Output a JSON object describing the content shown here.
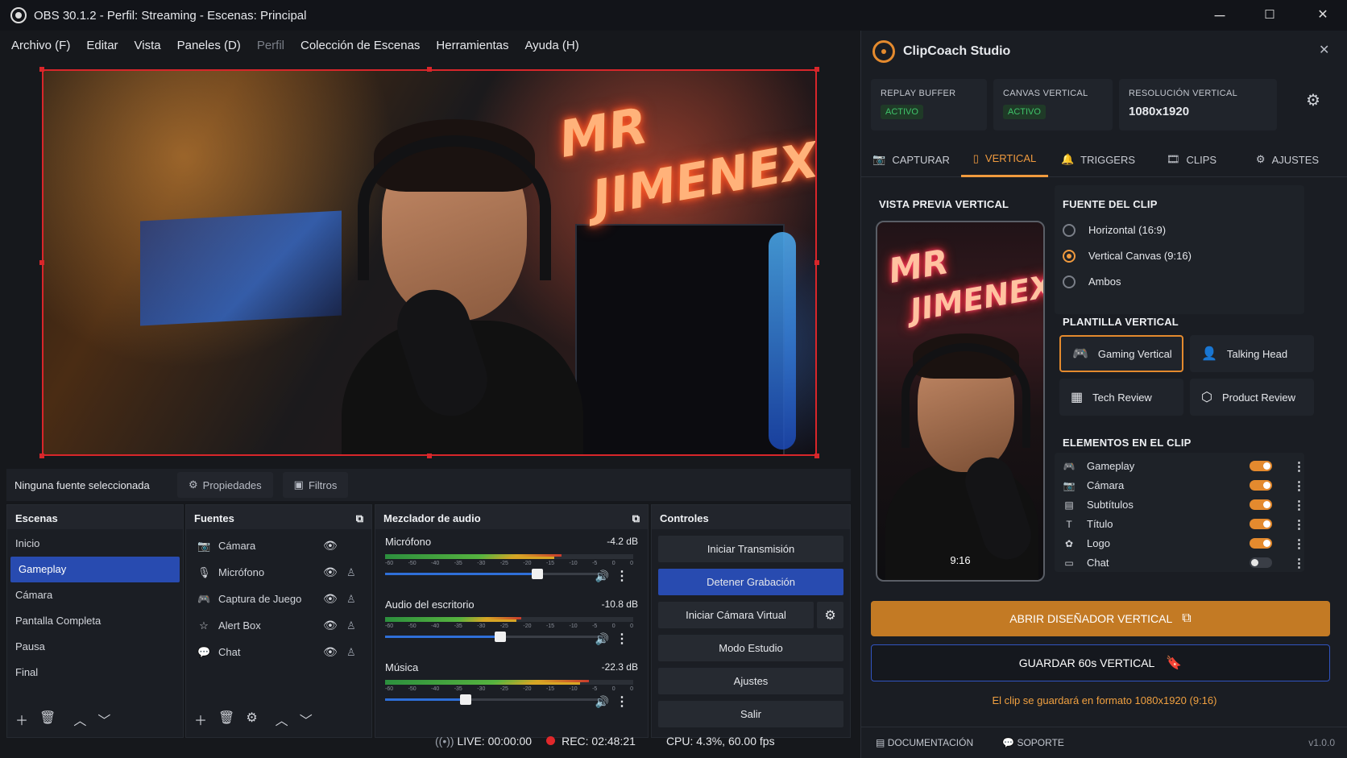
{
  "window": {
    "title": "OBS 30.1.2 - Perfil: Streaming - Escenas: Principal",
    "min": "─",
    "max": "☐",
    "close": "✕"
  },
  "menu": [
    "Archivo (F)",
    "Editar",
    "Vista",
    "Paneles (D)",
    "Perfil",
    "Colección de Escenas",
    "Herramientas",
    "Ayuda (H)"
  ],
  "preview": {
    "neon_line1": "MR",
    "neon_line2": "JIMENEX"
  },
  "source_bar": {
    "status": "Ninguna fuente seleccionada",
    "properties": "Propiedades",
    "filters": "Filtros"
  },
  "scenes": {
    "title": "Escenas",
    "items": [
      "Inicio",
      "Gameplay",
      "Cámara",
      "Pantalla Completa",
      "Pausa",
      "Final"
    ]
  },
  "sources": {
    "title": "Fuentes",
    "items": [
      "Cámara",
      "Micrófono",
      "Captura de Juego",
      "Alert Box",
      "Chat"
    ]
  },
  "mixer": {
    "title": "Mezclador de audio",
    "channels": [
      {
        "name": "Micrófono",
        "db": "-4.2 dB",
        "level": 0.71,
        "volume": 0.7
      },
      {
        "name": "Audio del escritorio",
        "db": "-10.8 dB",
        "level": 0.55,
        "volume": 0.53
      },
      {
        "name": "Música",
        "db": "-22.3 dB",
        "level": 0.82,
        "volume": 0.37
      }
    ],
    "ticks": [
      "-60",
      "-50",
      "-40",
      "-35",
      "-30",
      "-25",
      "-20",
      "-15",
      "-10",
      "-5",
      "0",
      "0"
    ]
  },
  "controls": {
    "title": "Controles",
    "buttons": [
      "Iniciar Transmisión",
      "Detener Grabación",
      "Iniciar Cámara Virtual",
      "Modo Estudio",
      "Ajustes",
      "Salir"
    ]
  },
  "status": {
    "live": "LIVE: 00:00:00",
    "rec": "REC: 02:48:21",
    "cpu": "CPU: 4.3%, 60.00 fps"
  },
  "panel": {
    "title": "ClipCoach Studio",
    "cards": [
      {
        "label": "REPLAY BUFFER",
        "value": "ACTIVO"
      },
      {
        "label": "CANVAS VERTICAL",
        "value": "ACTIVO"
      },
      {
        "label": "RESOLUCIÓN VERTICAL",
        "value": "1080x1920"
      }
    ],
    "tabs": [
      "CAPTURAR",
      "VERTICAL",
      "TRIGGERS",
      "CLIPS",
      "AJUSTES"
    ],
    "preview_title": "VISTA PREVIA VERTICAL",
    "preview_ratio": "9:16",
    "source_title": "FUENTE DEL CLIP",
    "sources": [
      "Horizontal (16:9)",
      "Vertical Canvas (9:16)",
      "Ambos"
    ],
    "template_title": "PLANTILLA VERTICAL",
    "templates": [
      "Gaming Vertical",
      "Talking Head",
      "Tech Review",
      "Product Review"
    ],
    "elements_title": "ELEMENTOS EN EL CLIP",
    "elements": [
      "Gameplay",
      "Cámara",
      "Subtítulos",
      "Título",
      "Logo",
      "Chat"
    ],
    "open_btn": "ABRIR DISEÑADOR VERTICAL",
    "save_btn": "GUARDAR 60s VERTICAL",
    "note": "El clip se guardará en formato 1080x1920 (9:16)",
    "footer": {
      "docs": "DOCUMENTACIÓN",
      "support": "SOPORTE",
      "version": "v1.0.0"
    }
  },
  "colors": {
    "accent": "#e48a2e",
    "selection": "#284bb0",
    "rec": "#e0282b"
  }
}
